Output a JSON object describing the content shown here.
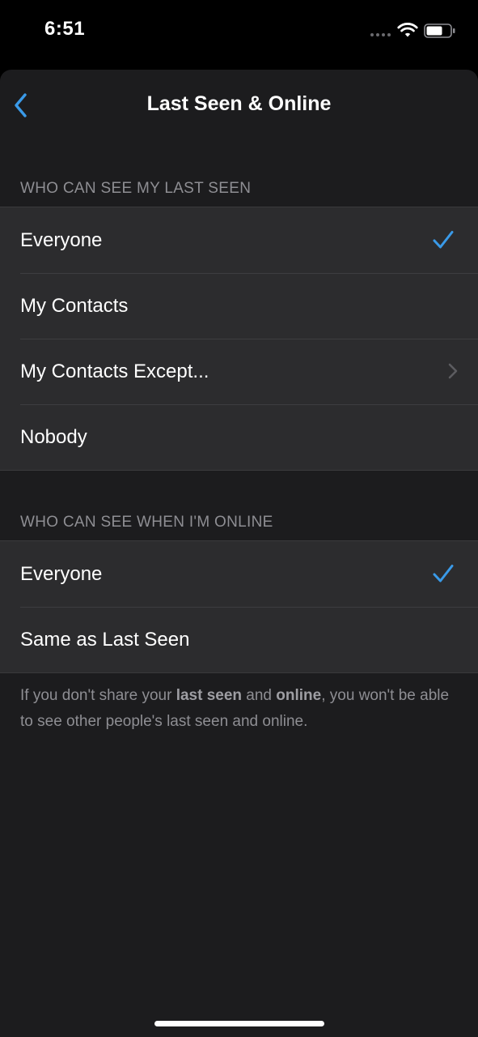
{
  "status_bar": {
    "time": "6:51",
    "icons": [
      "signal-dots-icon",
      "wifi-icon",
      "battery-icon"
    ]
  },
  "nav": {
    "back_icon": "chevron-left-icon",
    "title": "Last Seen & Online"
  },
  "last_seen": {
    "header": "WHO CAN SEE MY LAST SEEN",
    "options": [
      {
        "label": "Everyone",
        "selected": true
      },
      {
        "label": "My Contacts",
        "selected": false
      },
      {
        "label": "My Contacts Except...",
        "selected": false,
        "has_chevron": true
      },
      {
        "label": "Nobody",
        "selected": false
      }
    ]
  },
  "online": {
    "header": "WHO CAN SEE WHEN I'M ONLINE",
    "options": [
      {
        "label": "Everyone",
        "selected": true
      },
      {
        "label": "Same as Last Seen",
        "selected": false
      }
    ]
  },
  "footer": {
    "part1": "If you don't share your ",
    "bold1": "last seen",
    "part2": " and ",
    "bold2": "online",
    "part3": ", you won't be able to see other people's last seen and online."
  },
  "colors": {
    "accent": "#3a9ae8",
    "background": "#1c1c1e",
    "cell": "#2c2c2e",
    "secondary_text": "#8e8e93"
  }
}
